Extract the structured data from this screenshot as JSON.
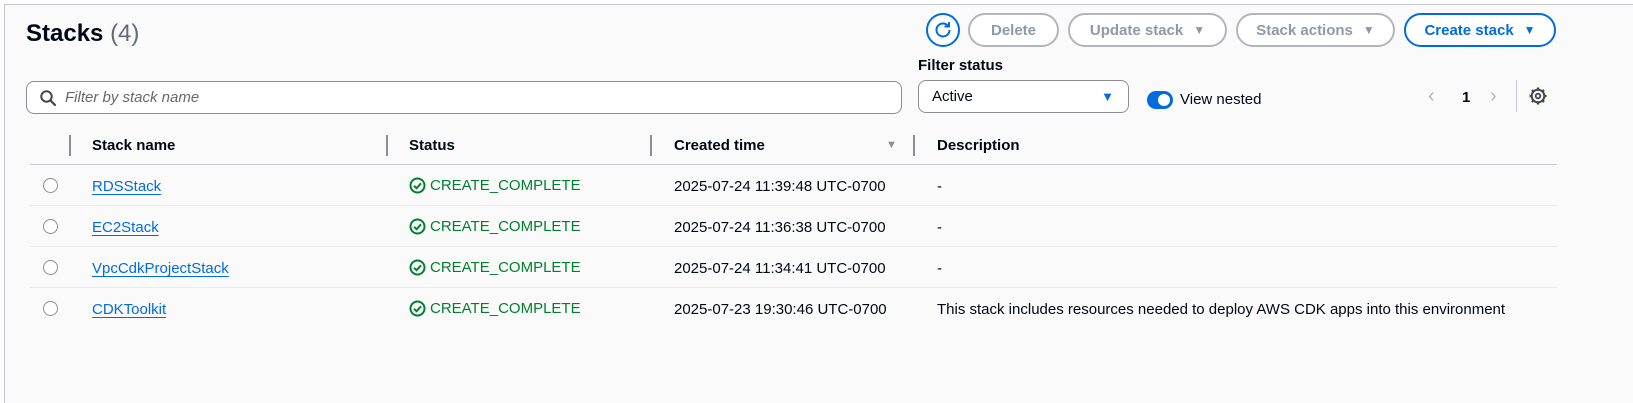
{
  "header": {
    "title": "Stacks",
    "count": "(4)"
  },
  "toolbar": {
    "refresh_icon": "refresh-icon",
    "delete_label": "Delete",
    "update_label": "Update stack",
    "actions_label": "Stack actions",
    "create_label": "Create stack",
    "accent_color": "#006ce0"
  },
  "filter": {
    "search_placeholder": "Filter by stack name",
    "status_label": "Filter status",
    "status_value": "Active",
    "view_nested_label": "View nested",
    "view_nested_on": true
  },
  "pagination": {
    "page": "1"
  },
  "table": {
    "columns": [
      "Stack name",
      "Status",
      "Created time",
      "Description"
    ],
    "rows": [
      {
        "name": "RDSStack",
        "status": "CREATE_COMPLETE",
        "created": "2025-07-24 11:39:48 UTC-0700",
        "description": "-"
      },
      {
        "name": "EC2Stack",
        "status": "CREATE_COMPLETE",
        "created": "2025-07-24 11:36:38 UTC-0700",
        "description": "-"
      },
      {
        "name": "VpcCdkProjectStack",
        "status": "CREATE_COMPLETE",
        "created": "2025-07-24 11:34:41 UTC-0700",
        "description": "-"
      },
      {
        "name": "CDKToolkit",
        "status": "CREATE_COMPLETE",
        "created": "2025-07-23 19:30:46 UTC-0700",
        "description": "This stack includes resources needed to deploy AWS CDK apps into this environment"
      }
    ],
    "status_color": "#00802f"
  }
}
